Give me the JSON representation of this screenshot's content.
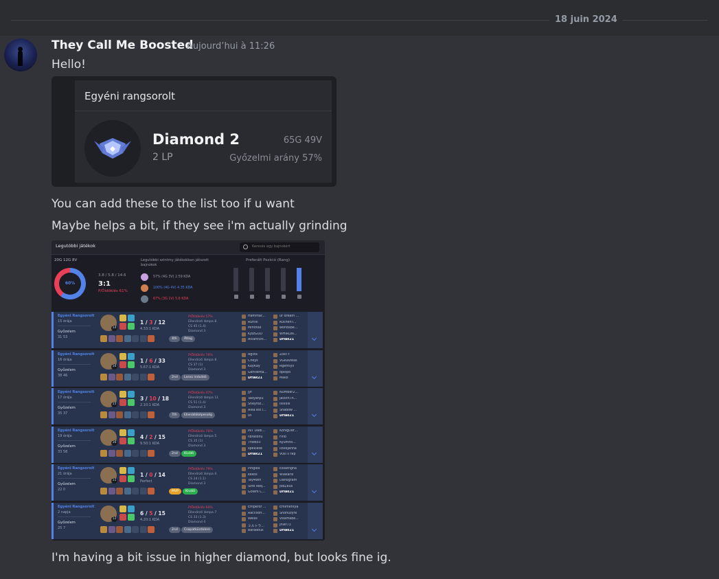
{
  "divider": {
    "date": "18 juin 2024"
  },
  "message": {
    "author": "They Call Me Boosted",
    "timestamp": "Aujourd’hui à 11:26",
    "lines": [
      "Hello!",
      "You can add these to the list too if u want",
      "Maybe helps a bit, if they see i'm actually grinding",
      "I'm having a bit issue in higher diamond, but looks fine ig."
    ]
  },
  "rank_card": {
    "title": "Egyéni rangsorolt",
    "rank": "Diamond 2",
    "lp": "2 LP",
    "record": "65G 49V",
    "winrate": "Győzelmi arány 57%"
  },
  "match_history": {
    "title": "Legutóbbi játékok",
    "search_placeholder": "Keresés egy bajnokért",
    "summary": {
      "record": "20G 12G 8V",
      "winrate_label": "60%",
      "winrate": 0.6,
      "kda_line": "3.8 / 5.8 / 14.6",
      "kda_ratio": "3:1",
      "kill_participation": "P/Öldöklés 61%",
      "champions_label": "Legutóbbi szintmy játékokban játszott bajnokok",
      "champions": [
        {
          "text": "57% (4G 3V)  2.59 KDA",
          "color": "#c9a0e0"
        },
        {
          "text": "100% (4G 4V)  4.35 KDA",
          "color": "#d08050"
        },
        {
          "text": "67% (3G 1V)  5.6 KDA",
          "color": "#6a7a8a"
        }
      ],
      "positions_label": "Preferált Pozíció (Rang)",
      "positions": [
        {
          "role": "top",
          "fill": 0
        },
        {
          "role": "jungle",
          "fill": 0
        },
        {
          "role": "mid",
          "fill": 0
        },
        {
          "role": "bot",
          "fill": 0
        },
        {
          "role": "support",
          "fill": 1
        }
      ]
    },
    "matches": [
      {
        "queue": "Egyéni Rangsorolt",
        "ago": "15 órája",
        "result": "Győzelem",
        "duration": "31 53",
        "level": "14",
        "kills": "1",
        "deaths": "3",
        "assists": "12",
        "kda_ratio": "4.33:1 KDA",
        "badge": "4th",
        "badge2": "Átlag",
        "stats": [
          "P/Öldöklés 57%",
          "Ellenőrző lámpa 8",
          "CS 45 (1.4)",
          "Diamond 3"
        ],
        "team1": [
          "Hammar...",
          "Runiiii",
          "Minthoe",
          "KjozGOD",
          "Alvaro5hi..."
        ],
        "team2": [
          "ur dream ...",
          "KuchenT...",
          "worldsbe...",
          "WHIRLIN...",
          "Driak21"
        ]
      },
      {
        "queue": "Egyéni Rangsorolt",
        "ago": "16 órája",
        "result": "Győzelem",
        "duration": "38 46",
        "level": "16",
        "kills": "1",
        "deaths": "6",
        "assists": "33",
        "kda_ratio": "5.67:1 KDA",
        "badge": "2nd",
        "badge2": "Lassú induláló",
        "stats": [
          "P/Öldöklés 76%",
          "Ellenőrző lámpa 8",
          "CS 37 (1)",
          "Diamond 3"
        ],
        "team1": [
          "Agiita",
          "Cheys",
          "KayKay",
          "Gentlema...",
          "Driak21"
        ],
        "team2": [
          "ZoeTY",
          "VGKavleas",
          "Rgentlyv",
          "opiopo",
          "Mako"
        ]
      },
      {
        "queue": "Egyéni Rangsorolt",
        "ago": "17 órája",
        "result": "Győzelem",
        "duration": "35 37",
        "level": "15",
        "kills": "3",
        "deaths": "10",
        "assists": "18",
        "kda_ratio": "2.10:1 KDA",
        "badge": "7th",
        "badge2": "Ellenállóképesség",
        "stats": [
          "P/Öldöklés 47%",
          "Ellenőrző lámpa 11",
          "CS 51 (1.4)",
          "Diamond 3"
        ],
        "team1": [
          "jyf",
          "Taoyanjiu",
          "Sheyroz...",
          "Alea est i...",
          "Izi"
        ],
        "team2": [
          "Number2...",
          "JacktnTh...",
          "IIIIIIIIIII",
          "Shadow ...",
          "Driak21"
        ]
      },
      {
        "queue": "Egyéni Rangsorolt",
        "ago": "19 órája",
        "result": "Győzelem",
        "duration": "33 58",
        "level": "16",
        "kills": "4",
        "deaths": "2",
        "assists": "15",
        "kda_ratio": "9.50:1 KDA",
        "badge": "2nd",
        "badge2": "Kiváló",
        "stats": [
          "P/Öldöklés 76%",
          "Ellenőrző lámpa 5",
          "CS 35 (1)",
          "Diamond 3"
        ],
        "team1": [
          "INT Dadi...",
          "libratohu",
          "TheNo3",
          "spekiese",
          "Driak21"
        ],
        "team2": [
          "KönigDer...",
          "Firio",
          "Kyumho...",
          "IloveJanna",
          "Vusi il rap"
        ]
      },
      {
        "queue": "Egyéni Rangsorolt",
        "ago": "21 órája",
        "result": "Győzelem",
        "duration": "22 0",
        "level": "11",
        "kills": "1",
        "deaths": "0",
        "assists": "14",
        "kda_ratio": "Perfect",
        "badge": "MVP",
        "badge2": "Kiváló",
        "stats": [
          "P/Öldöklés 79%",
          "Ellenőrző lámpa 4",
          "CS 24 (1.1)",
          "Diamond 3"
        ],
        "team1": [
          "Pingleo",
          "kekos",
          "Tay4win",
          "Sine Req...",
          "Gólem C..."
        ],
        "team2": [
          "Essathgha",
          "Wiakarili",
          "Danogram",
          "JobZeus",
          "Driak21"
        ]
      },
      {
        "queue": "Egyéni Rangsorolt",
        "ago": "2 napja",
        "result": "Győzelem",
        "duration": "25 7",
        "level": "12",
        "kills": "6",
        "deaths": "5",
        "assists": "15",
        "kda_ratio": "4.20:1 KDA",
        "badge": "2nd",
        "badge2": "Csapatküzdelem",
        "stats": [
          "P/Öldöklés 60%",
          "Ellenőrző lámpa 7",
          "CS 33 (1.3)",
          "Diamond 4"
        ],
        "team1": [
          "Emperor ...",
          "Raccoon...",
          "Weiss",
          "ミルトラ...",
          "Baradous"
        ],
        "team2": [
          "Emimentya",
          "Shonuzyre",
          "visamabe...",
          "jnier73",
          "Driak21"
        ]
      }
    ]
  }
}
